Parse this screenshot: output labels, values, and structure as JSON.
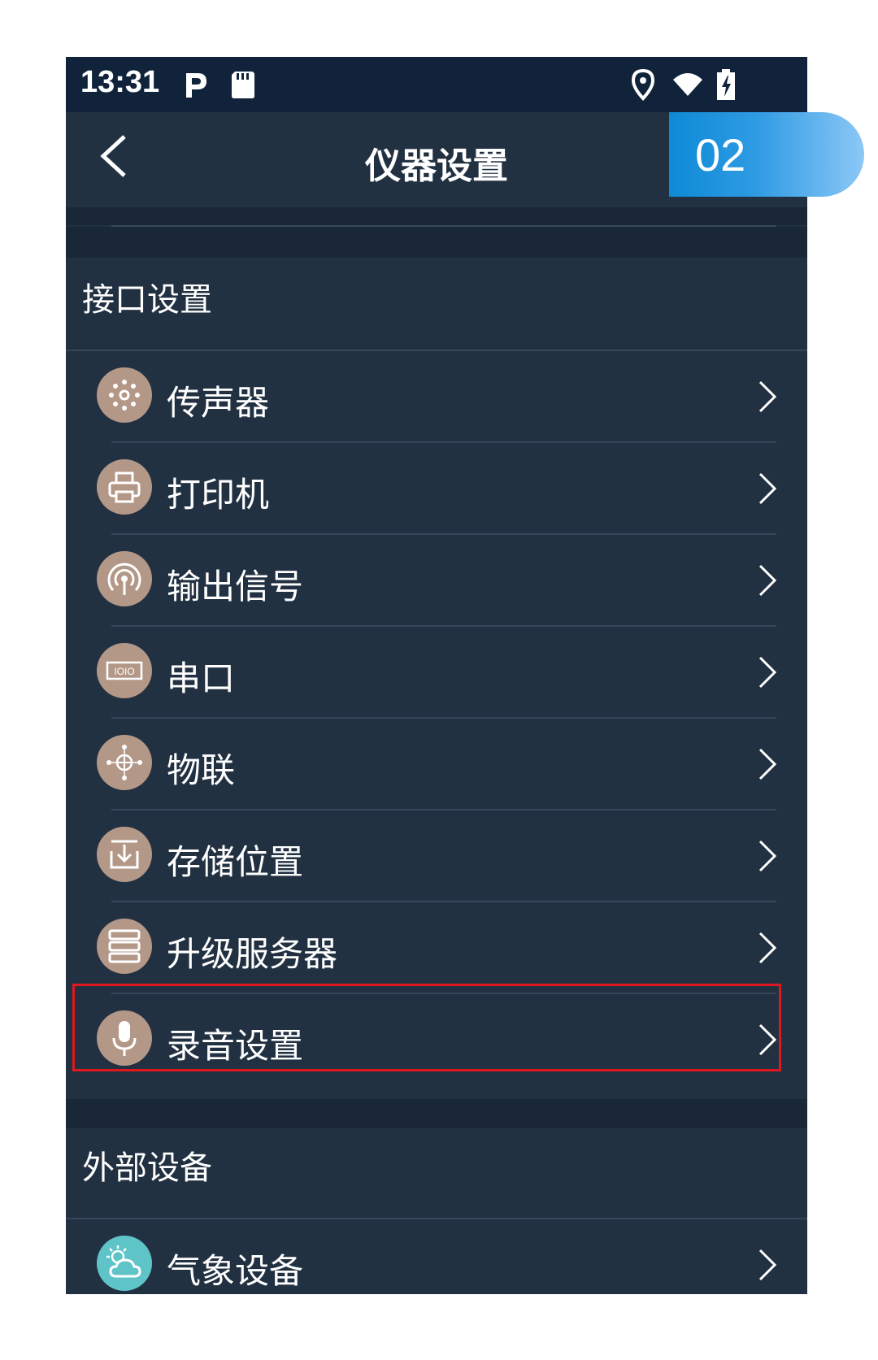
{
  "status_bar": {
    "time": "13:31",
    "icons": [
      "parking-icon",
      "sd-card-icon",
      "location-icon",
      "wifi-icon",
      "battery-charging-icon"
    ]
  },
  "app_bar": {
    "title": "仪器设置",
    "back_icon": "chevron-left-icon"
  },
  "badge": {
    "label": "02",
    "color": "#0e8ad6"
  },
  "sections": [
    {
      "title": "接口设置",
      "items": [
        {
          "label": "传声器",
          "icon": "microphone-mesh-icon"
        },
        {
          "label": "打印机",
          "icon": "printer-icon"
        },
        {
          "label": "输出信号",
          "icon": "signal-broadcast-icon"
        },
        {
          "label": "串口",
          "icon": "serial-port-icon",
          "icon_text": "IOIO"
        },
        {
          "label": "物联",
          "icon": "iot-globe-icon"
        },
        {
          "label": "存储位置",
          "icon": "storage-download-icon"
        },
        {
          "label": "升级服务器",
          "icon": "server-icon"
        },
        {
          "label": "录音设置",
          "icon": "microphone-icon",
          "highlighted": true
        }
      ]
    },
    {
      "title": "外部设备",
      "items": [
        {
          "label": "气象设备",
          "icon": "weather-cloud-sun-icon"
        }
      ]
    }
  ],
  "colors": {
    "background": "#223142",
    "status_bar": "#10233b",
    "separator": "#1a2737",
    "icon_circle": "#b39888",
    "weather_icon_circle": "#5ec4c7",
    "highlight_border": "#e0171f"
  }
}
